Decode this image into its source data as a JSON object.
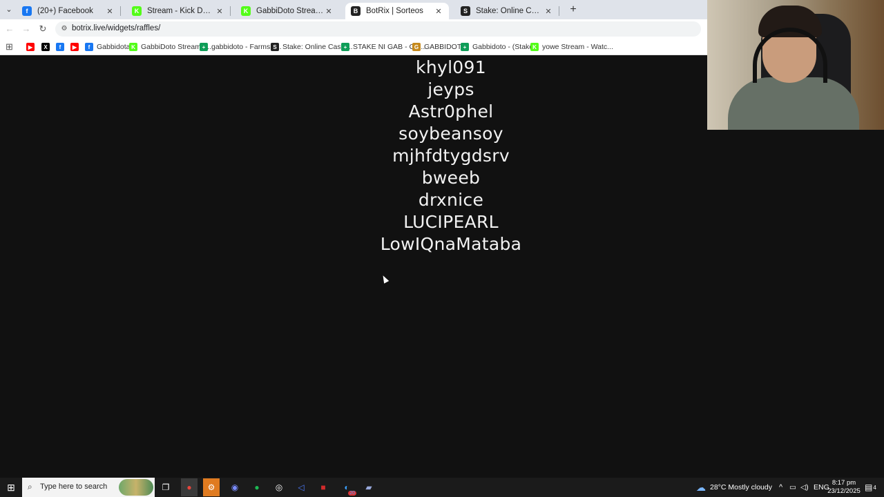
{
  "browser": {
    "tabs": [
      {
        "title": "(20+) Facebook",
        "icon": "facebook-icon",
        "color": "#1877f2",
        "glyph": "f"
      },
      {
        "title": "Stream - Kick Dashboard",
        "icon": "kick-icon",
        "color": "#53fc18",
        "glyph": "K"
      },
      {
        "title": "GabbiDoto Stream - Watch Live",
        "icon": "kick-icon",
        "color": "#53fc18",
        "glyph": "K"
      },
      {
        "title": "BotRix | Sorteos",
        "icon": "botrix-icon",
        "color": "#222222",
        "glyph": "B"
      },
      {
        "title": "Stake: Online Casino & Sports",
        "icon": "stake-icon",
        "color": "#222222",
        "glyph": "S"
      }
    ],
    "active_tab": 3,
    "new_tab_symbol": "+",
    "url": "botrix.live/widgets/raffles/",
    "bookmarks": [
      {
        "label": "",
        "icon": "youtube-icon",
        "color": "#ff0000",
        "glyph": "▶"
      },
      {
        "label": "",
        "icon": "x-icon",
        "color": "#000000",
        "glyph": "X"
      },
      {
        "label": "",
        "icon": "facebook-icon",
        "color": "#1877f2",
        "glyph": "f"
      },
      {
        "label": "",
        "icon": "youtube-icon",
        "color": "#ff0000",
        "glyph": "▶"
      },
      {
        "label": "Gabbidota",
        "icon": "facebook-icon",
        "color": "#1877f2",
        "glyph": "f"
      },
      {
        "label": "GabbiDoto Stream -...",
        "icon": "kick-icon",
        "color": "#53fc18",
        "glyph": "K"
      },
      {
        "label": "gabbidoto - Farmski...",
        "icon": "sheets-icon",
        "color": "#0f9d58",
        "glyph": "+"
      },
      {
        "label": "Stake: Online Casin...",
        "icon": "stake-icon",
        "color": "#222222",
        "glyph": "S"
      },
      {
        "label": "STAKE NI GAB - Go...",
        "icon": "sheets-icon",
        "color": "#0f9d58",
        "glyph": "+"
      },
      {
        "label": "GABBIDOTO",
        "icon": "gabbidoto-icon",
        "color": "#c68a1d",
        "glyph": "G"
      },
      {
        "label": "Gabbidoto - (Stake...",
        "icon": "sheets-icon",
        "color": "#0f9d58",
        "glyph": "+"
      },
      {
        "label": "yowe Stream - Watc...",
        "icon": "kick-icon",
        "color": "#53fc18",
        "glyph": "K"
      }
    ]
  },
  "raffle": {
    "names": [
      "khyl091",
      "jeyps",
      "Astr0phel",
      "soybeansoy",
      "mjhfdtygdsrv",
      "bweeb",
      "drxnice",
      "LUCIPEARL",
      "LowIQnaMataba"
    ]
  },
  "taskbar": {
    "search_placeholder": "Type here to search",
    "weather": "28°C  Mostly cloudy",
    "language": "ENG",
    "time": "8:17 pm",
    "date": "23/12/2025",
    "notification_count": "4",
    "spotify_badge": "20"
  }
}
